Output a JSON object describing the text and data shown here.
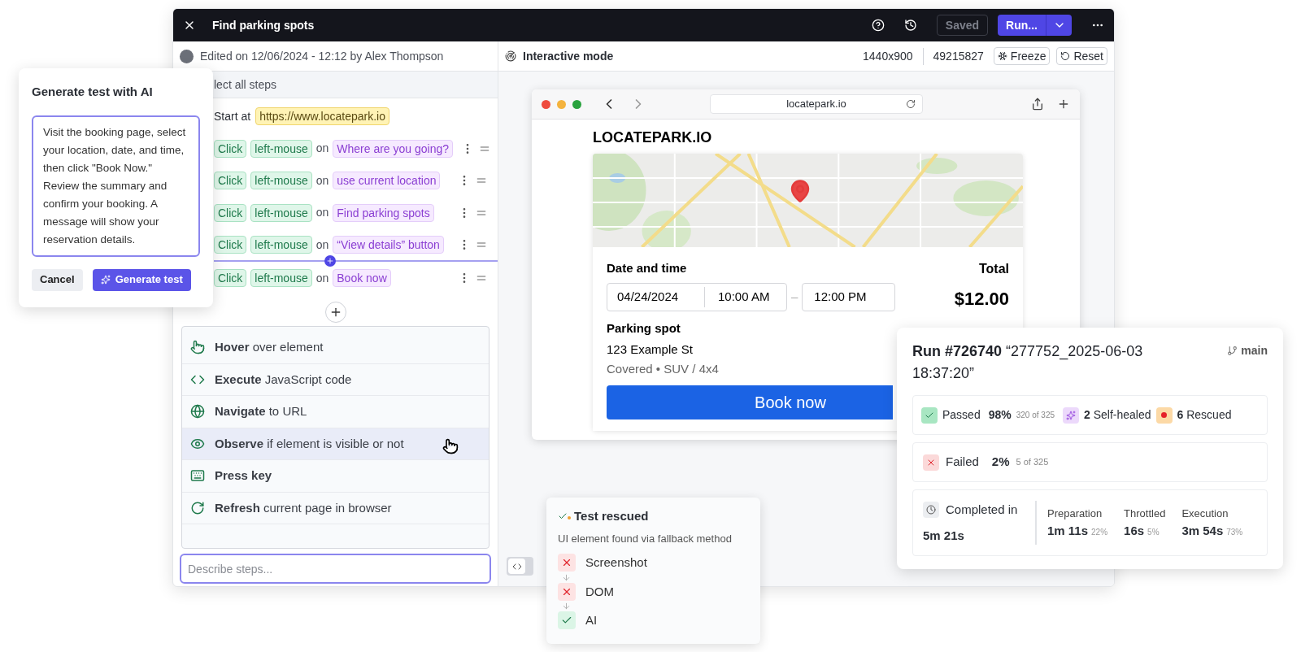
{
  "window": {
    "title": "Find parking spots",
    "saved": "Saved",
    "run": "Run..."
  },
  "editor": {
    "edited": "Edited on 12/06/2024 - 12:12 by Alex Thompson",
    "select_all": "lect all steps",
    "start": {
      "label": "Start at",
      "url": "https://www.locatepark.io"
    },
    "steps": [
      {
        "action": "Click",
        "button": "left-mouse",
        "on": "on",
        "target": "Where are you going?"
      },
      {
        "action": "Click",
        "button": "left-mouse",
        "on": "on",
        "target": "use current location"
      },
      {
        "action": "Click",
        "button": "left-mouse",
        "on": "on",
        "target": "Find parking spots"
      },
      {
        "action": "Click",
        "button": "left-mouse",
        "on": "on",
        "target": "“View details” button"
      },
      {
        "action": "Click",
        "button": "left-mouse",
        "on": "on",
        "target": "Book now"
      }
    ],
    "menu": [
      {
        "kind": "hover",
        "text": "**Hover** over element",
        "selected": false
      },
      {
        "kind": "code",
        "text": "**Execute** JavaScript code",
        "selected": false
      },
      {
        "kind": "globe",
        "text": "**Navigate** to URL",
        "selected": false
      },
      {
        "kind": "eye",
        "text": "**Observe** if element is visible or not",
        "selected": true
      },
      {
        "kind": "keyboard",
        "text": "**Press key**",
        "selected": false
      },
      {
        "kind": "refresh",
        "text": "**Refresh** current page in browser",
        "selected": false
      }
    ],
    "describe_placeholder": "Describe steps..."
  },
  "preview": {
    "mode": "Interactive mode",
    "resolution": "1440x900",
    "id": "49215827",
    "freeze": "Freeze",
    "reset": "Reset"
  },
  "browser": {
    "url": "locatepark.io",
    "logo": "LOCATEPARK.IO",
    "date_label": "Date and time",
    "date": "04/24/2024",
    "start_time": "10:00 AM",
    "dash": "–",
    "end_time": "12:00 PM",
    "total_label": "Total",
    "total": "$12.00",
    "spot_label": "Parking spot",
    "address": "123 Example St",
    "details": "Covered • SUV / 4x4",
    "book": "Book now"
  },
  "ai_dialog": {
    "title": "Generate test with AI",
    "prompt": "Visit the booking page, select your location, date, and time, then click \"Book Now.\" Review the summary and confirm your booking. A message will show your reservation details.",
    "cancel": "Cancel",
    "generate": "Generate test"
  },
  "run": {
    "title": "Run #726740 “277752_2025-06-03 18:37:20”",
    "branch": "main",
    "passed": {
      "label": "Passed",
      "pct": "98%",
      "count": "320 of 325"
    },
    "healed": "**2** Self-healed",
    "rescued": "**6** Rescued",
    "failed": {
      "label": "Failed",
      "pct": "2%",
      "count": "5 of 325"
    },
    "completed_label": "Completed in",
    "completed": "5m 21s",
    "phases": [
      {
        "label": "Preparation",
        "time": "1m 11s",
        "pct": "22%"
      },
      {
        "label": "Throttled",
        "time": "16s",
        "pct": "5%"
      },
      {
        "label": "Execution",
        "time": "3m 54s",
        "pct": "73%"
      }
    ]
  },
  "rescue": {
    "title": "Test rescued",
    "subtitle": "UI element found via fallback method",
    "methods": [
      {
        "name": "Screenshot",
        "passed": false
      },
      {
        "name": "DOM",
        "passed": false
      },
      {
        "name": "AI",
        "passed": true
      }
    ]
  }
}
